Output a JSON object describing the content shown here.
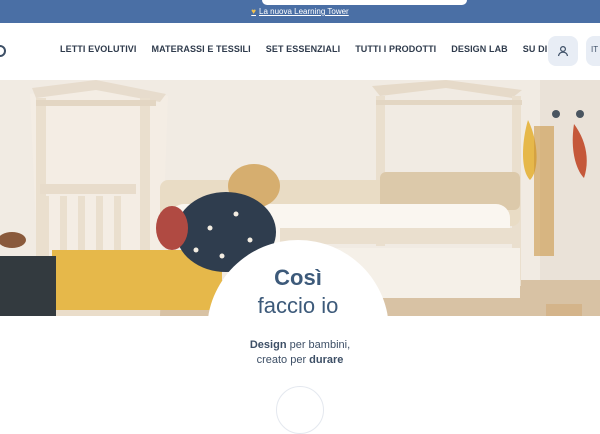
{
  "announcement": {
    "icon": "heart-icon",
    "text": "La nuova Learning Tower"
  },
  "nav": {
    "items": [
      "LETTI EVOLUTIVI",
      "MATERASSI E TESSILI",
      "SET ESSENZIALI",
      "TUTTI I PRODOTTI",
      "DESIGN LAB",
      "SU DI NOI"
    ]
  },
  "header": {
    "lang_label": "IT"
  },
  "hero": {
    "headline_line1": "Così",
    "headline_line2": "faccio io",
    "tagline_part1": "Design",
    "tagline_part2": " per bambini,",
    "tagline_part3": "creato per ",
    "tagline_part4": "durare"
  },
  "colors": {
    "announcement_bg": "#4a6fa5",
    "accent": "#3d5a7a"
  }
}
